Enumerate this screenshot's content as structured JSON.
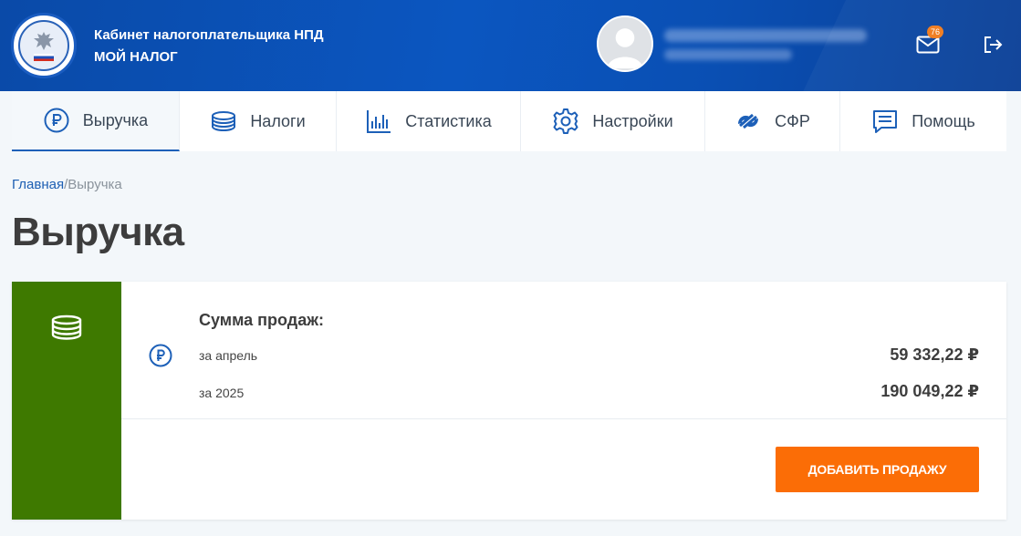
{
  "header": {
    "brand_line1": "Кабинет налогоплательщика НПД",
    "brand_line2": "МОЙ НАЛОГ",
    "notifications_count": "76",
    "logo_icon": "fns-emblem-icon",
    "mail_icon": "mail-icon",
    "logout_icon": "logout-icon"
  },
  "nav": {
    "items": [
      {
        "label": "Выручка",
        "icon": "ruble-icon",
        "active": true
      },
      {
        "label": "Налоги",
        "icon": "coins-icon"
      },
      {
        "label": "Статистика",
        "icon": "bar-chart-icon"
      },
      {
        "label": "Настройки",
        "icon": "gear-icon"
      },
      {
        "label": "СФР",
        "icon": "sfr-icon"
      },
      {
        "label": "Помощь",
        "icon": "chat-icon"
      }
    ]
  },
  "breadcrumb": {
    "home": "Главная",
    "separator": "/",
    "current": "Выручка"
  },
  "page": {
    "title": "Выручка"
  },
  "sales": {
    "title": "Сумма продаж:",
    "rows": [
      {
        "label": "за апрель",
        "value": "59 332,22 ₽"
      },
      {
        "label": "за 2025",
        "value": "190 049,22 ₽"
      }
    ],
    "add_button": "ДОБАВИТЬ ПРОДАЖУ"
  },
  "colors": {
    "header_blue": "#0b56c0",
    "accent_blue": "#1d60b8",
    "card_green": "#3e7900",
    "button_orange": "#fb6d06",
    "badge_orange": "#f07a1c"
  }
}
